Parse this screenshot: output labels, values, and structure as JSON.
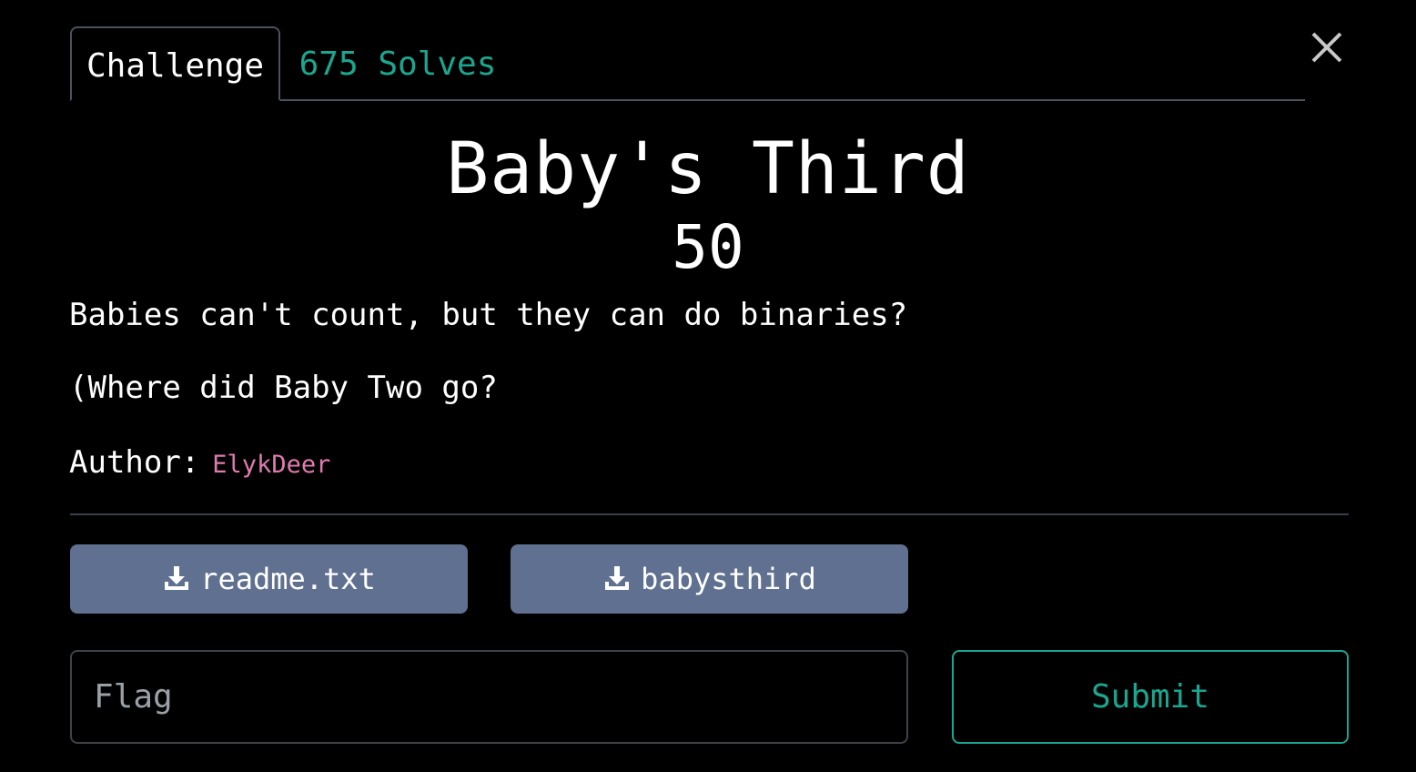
{
  "tabs": {
    "challenge_label": "Challenge",
    "solves_label": "675 Solves"
  },
  "challenge": {
    "title": "Baby's Third",
    "points": "50",
    "description_line1": "Babies can't count, but they can do binaries?",
    "description_line2": "(Where did Baby Two go?",
    "author_label": "Author:",
    "author_name": "ElykDeer"
  },
  "files": [
    {
      "name": "readme.txt",
      "icon": "download-icon"
    },
    {
      "name": "babysthird",
      "icon": "download-icon"
    }
  ],
  "form": {
    "flag_placeholder": "Flag",
    "flag_value": "",
    "submit_label": "Submit"
  },
  "colors": {
    "background": "#000000",
    "accent_teal": "#1aa68f",
    "author_pink": "#e07bb0",
    "file_button": "#5f7090"
  },
  "icons": {
    "close": "close-icon",
    "download": "download-icon"
  }
}
